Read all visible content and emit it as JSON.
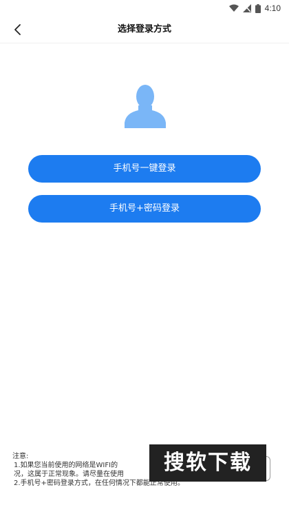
{
  "status_bar": {
    "time": "4:10",
    "icons": [
      "wifi-icon",
      "signal-icon",
      "battery-icon"
    ]
  },
  "nav": {
    "back_icon": "chevron-left-icon",
    "title": "选择登录方式"
  },
  "avatar": {
    "icon": "user-avatar-icon",
    "color": "#7ab6f7"
  },
  "buttons": {
    "one_key_login": "手机号一键登录",
    "password_login": "手机号+密码登录",
    "color": "#1d7cf0"
  },
  "notes": {
    "heading": "注意:",
    "line1": "1.如果您当前使用的网络是WIFI的",
    "line2": "况，这属于正常现象。请尽量在使用",
    "line3": "2.手机号+密码登录方式，在任何情况下都能正常使用。"
  },
  "watermark": {
    "text": "搜软下载"
  }
}
